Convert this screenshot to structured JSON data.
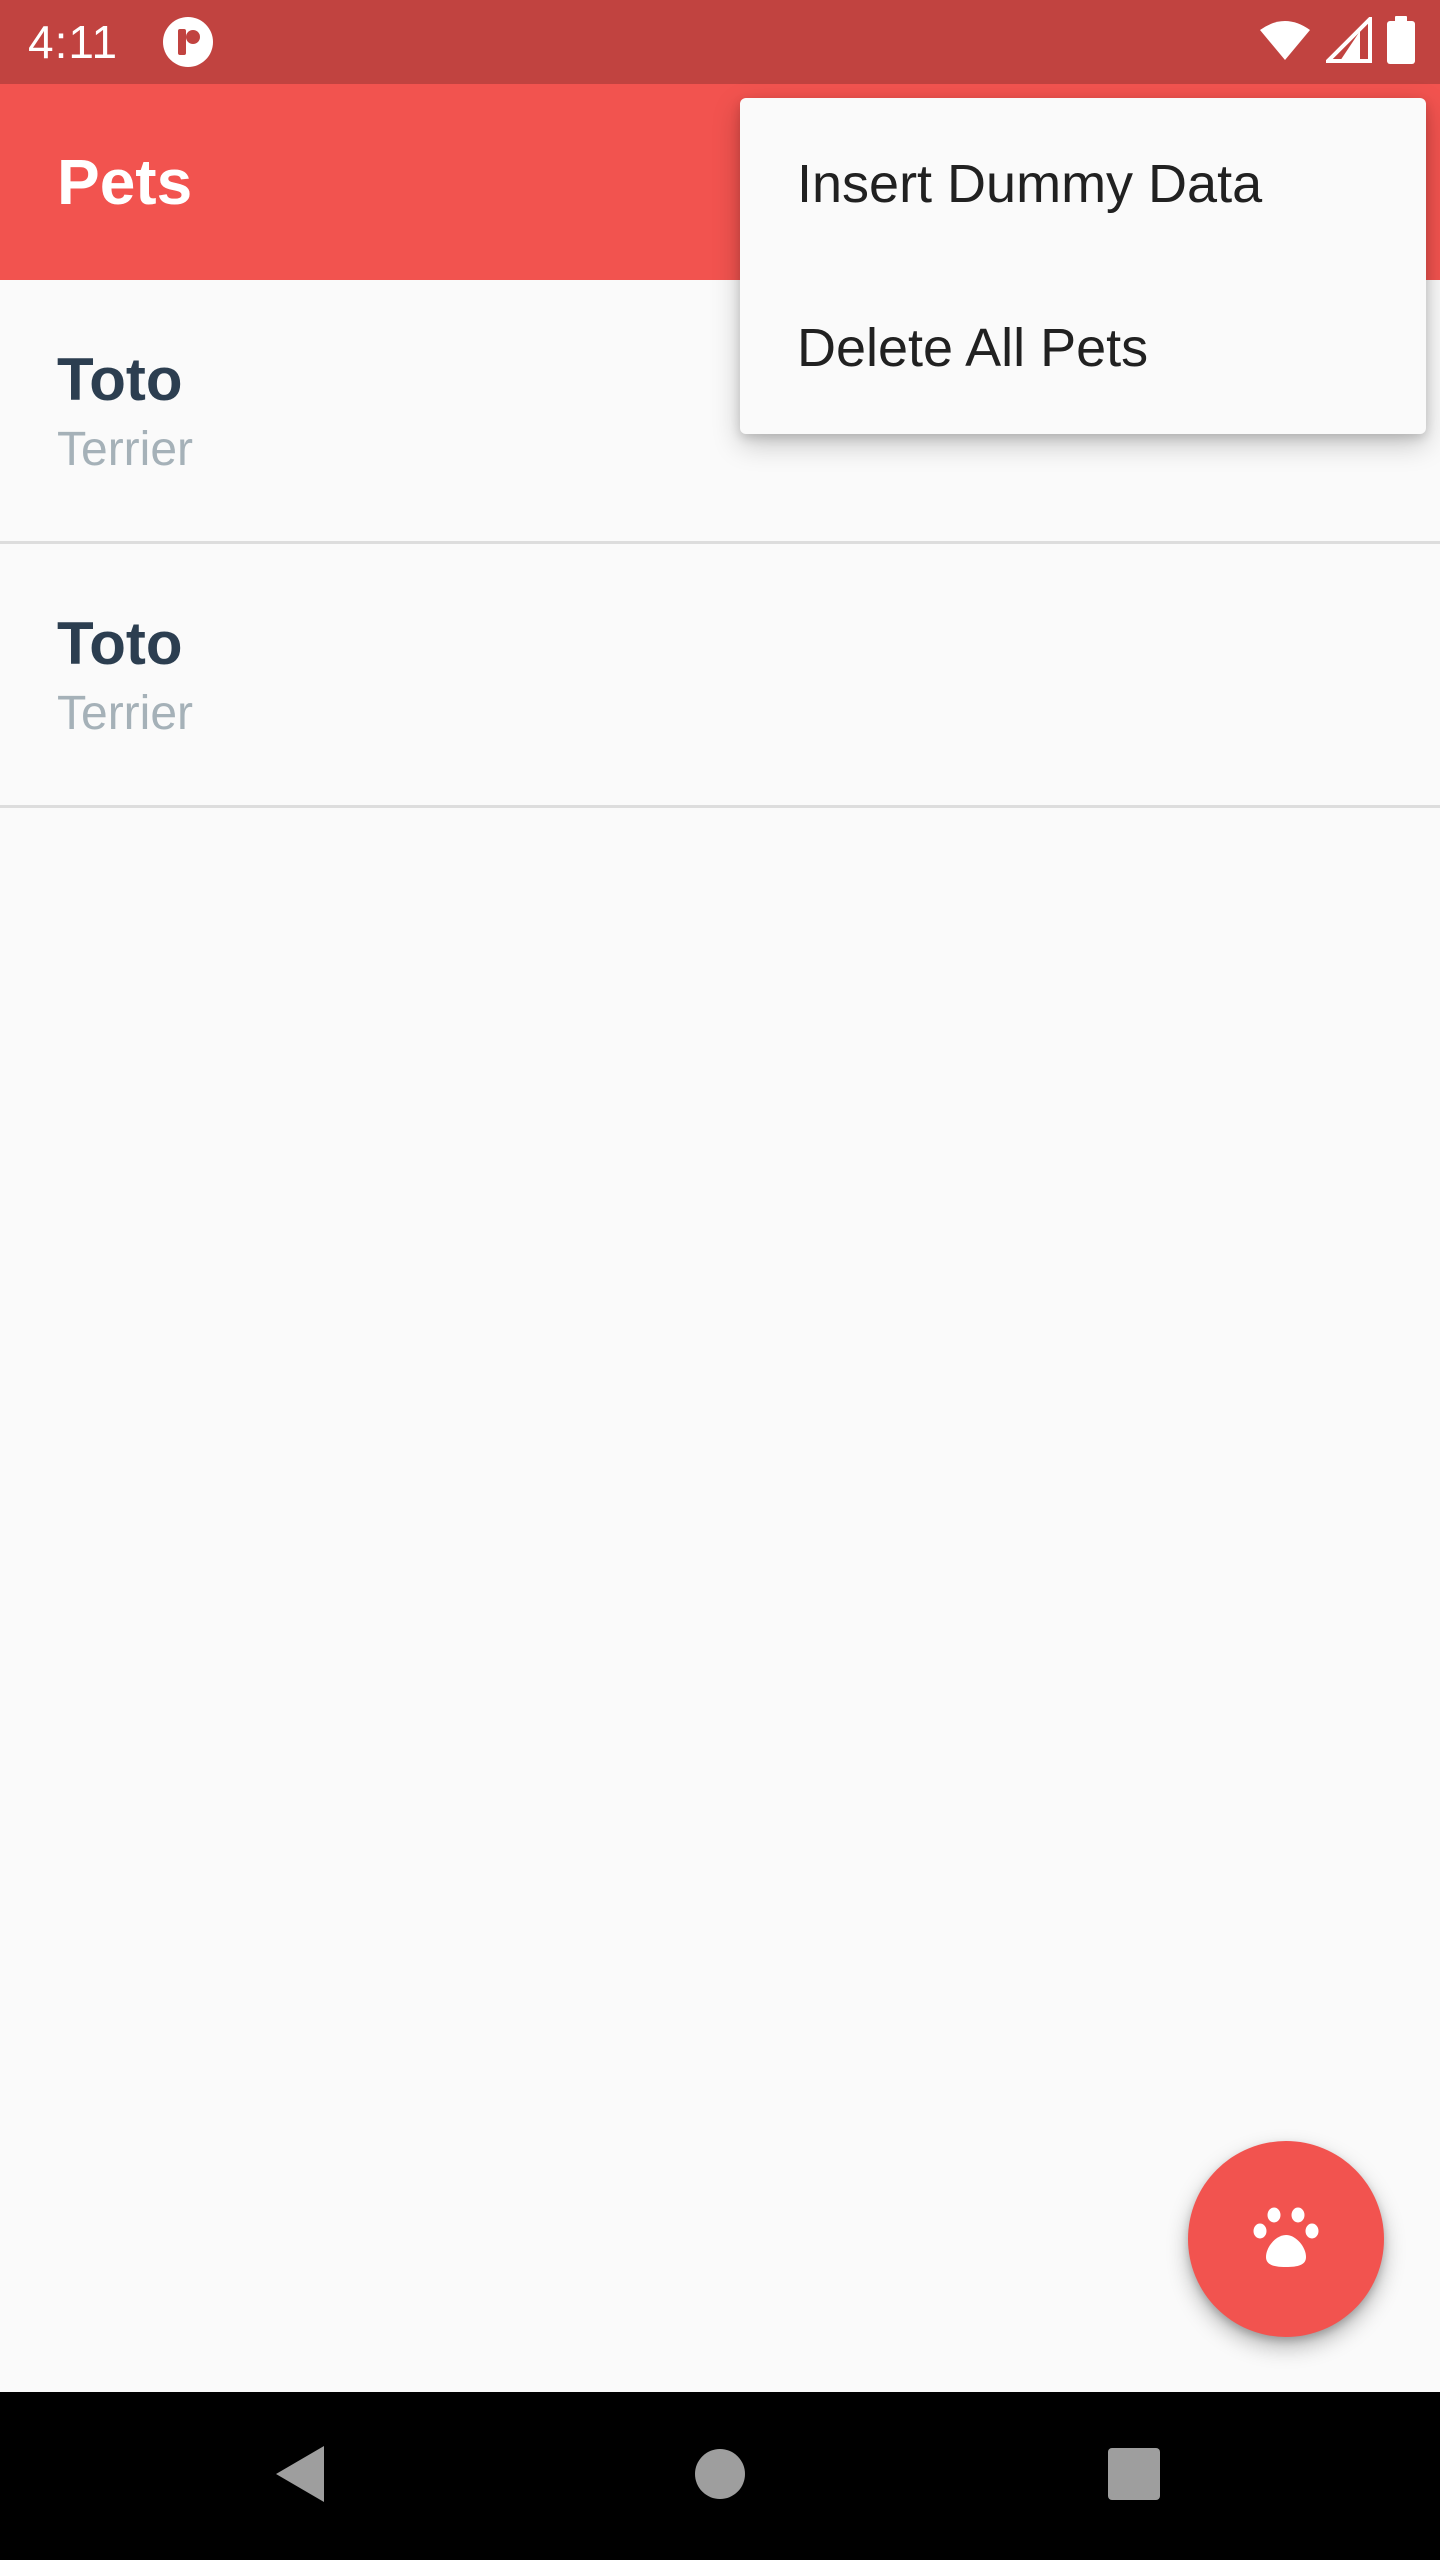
{
  "status_bar": {
    "time": "4:11",
    "icons": [
      "app-notification-icon",
      "wifi-icon",
      "signal-icon",
      "battery-icon"
    ],
    "color": "#c14340"
  },
  "app_bar": {
    "title": "Pets",
    "color": "#f2534f"
  },
  "pets": [
    {
      "name": "Toto",
      "breed": "Terrier"
    },
    {
      "name": "Toto",
      "breed": "Terrier"
    }
  ],
  "overflow_menu": {
    "items": [
      {
        "label": "Insert Dummy Data"
      },
      {
        "label": "Delete All Pets"
      }
    ]
  },
  "fab": {
    "icon": "paw-icon",
    "color": "#f2534f"
  },
  "nav_bar": {
    "buttons": [
      "back-icon",
      "home-icon",
      "recents-icon"
    ]
  }
}
